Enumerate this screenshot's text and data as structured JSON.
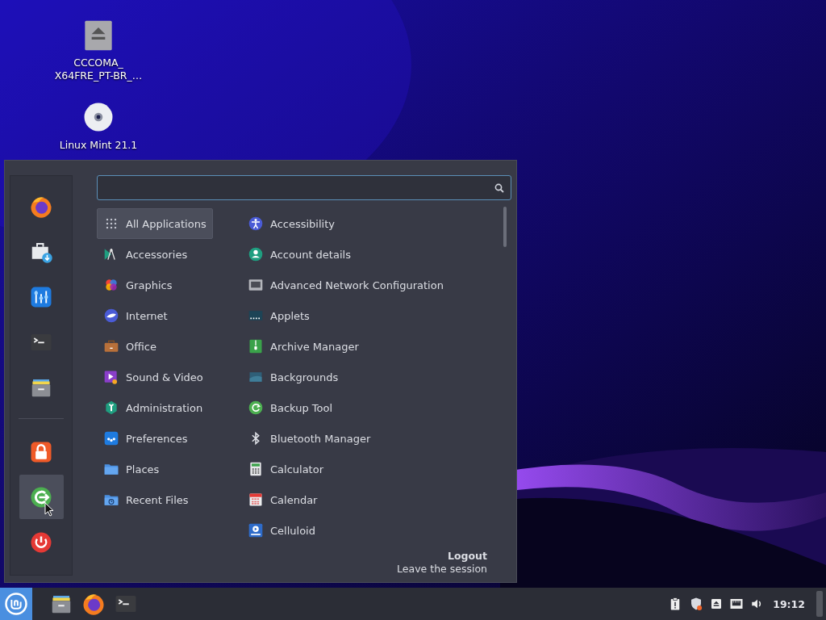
{
  "desktop_icons": [
    {
      "lines": [
        "CCCOMA_",
        "X64FRE_PT-BR_…"
      ]
    },
    {
      "lines": [
        "Linux Mint 21.1"
      ]
    }
  ],
  "menu": {
    "favorites": [
      {
        "selected": false
      },
      {
        "selected": false
      },
      {
        "selected": false
      },
      {
        "selected": false
      },
      {
        "selected": false
      }
    ],
    "session": [
      {
        "selected": false
      },
      {
        "selected": true
      },
      {
        "selected": false
      }
    ],
    "categories": [
      {
        "label": "All Applications",
        "selected": true
      },
      {
        "label": "Accessories",
        "selected": false
      },
      {
        "label": "Graphics",
        "selected": false
      },
      {
        "label": "Internet",
        "selected": false
      },
      {
        "label": "Office",
        "selected": false
      },
      {
        "label": "Sound & Video",
        "selected": false
      },
      {
        "label": "Administration",
        "selected": false
      },
      {
        "label": "Preferences",
        "selected": false
      },
      {
        "label": "Places",
        "selected": false
      },
      {
        "label": "Recent Files",
        "selected": false
      }
    ],
    "applications": [
      "Accessibility",
      "Account details",
      "Advanced Network Configuration",
      "Applets",
      "Archive Manager",
      "Backgrounds",
      "Backup Tool",
      "Bluetooth Manager",
      "Calculator",
      "Calendar",
      "Celluloid"
    ],
    "footer": {
      "title": "Logout",
      "description": "Leave the session"
    }
  },
  "taskbar": {
    "clock": "19:12"
  }
}
